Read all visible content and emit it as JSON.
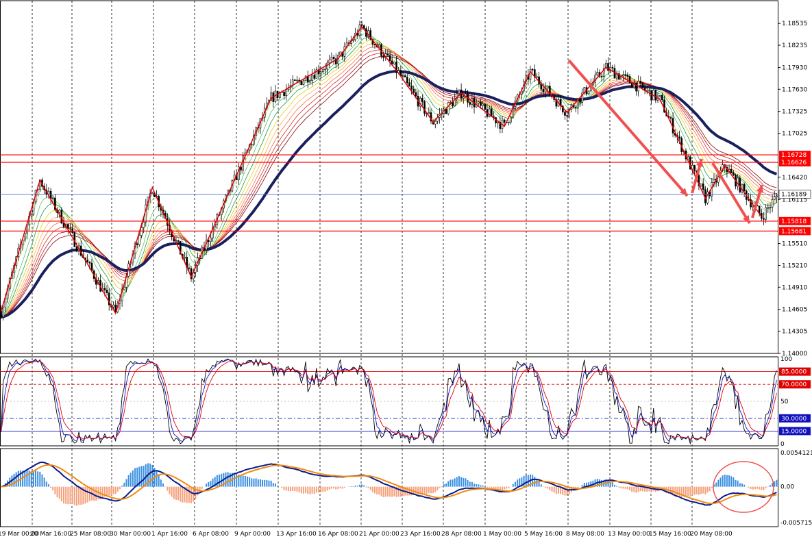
{
  "chart_data": [
    {
      "type": "candlestick",
      "panel": "price",
      "ylim": [
        1.14,
        1.188
      ],
      "y_ticks": [
        "1.18535",
        "1.18235",
        "1.17930",
        "1.17630",
        "1.17325",
        "1.17025",
        "1.16420",
        "1.16115",
        "1.15510",
        "1.15210",
        "1.14910",
        "1.14605",
        "1.14305",
        "1.14000"
      ],
      "y_tick_values": [
        1.18535,
        1.18235,
        1.1793,
        1.1763,
        1.17325,
        1.17025,
        1.1642,
        1.16115,
        1.1551,
        1.1521,
        1.1491,
        1.14605,
        1.14305,
        1.14
      ],
      "x_ticks": [
        "19 Mar 00:00",
        "20 Mar 16:00",
        "25 Mar 08:00",
        "30 Mar 00:00",
        "1 Apr 16:00",
        "6 Apr 08:00",
        "9 Apr 00:00",
        "13 Apr 16:00",
        "16 Apr 08:00",
        "21 Apr 00:00",
        "23 Apr 16:00",
        "28 Apr 08:00",
        "1 May 00:00",
        "5 May 16:00",
        "8 May 08:00",
        "13 May 00:00",
        "15 May 16:00",
        "20 May 08:00"
      ],
      "current_price": "1.16189",
      "levels": [
        {
          "label": "1.16728",
          "value": 1.16728,
          "color": "#ff0000"
        },
        {
          "label": "1.16626",
          "value": 1.16626,
          "color": "#ff0000"
        },
        {
          "label": "1.15818",
          "value": 1.15818,
          "color": "#ff0000"
        },
        {
          "label": "1.15681",
          "value": 1.15681,
          "color": "#ff0000"
        }
      ],
      "zigzag": [
        [
          0,
          1.1458
        ],
        [
          18,
          1.1638
        ],
        [
          53,
          1.1455
        ],
        [
          70,
          1.1628
        ],
        [
          88,
          1.1505
        ],
        [
          125,
          1.1751
        ],
        [
          156,
          1.1805
        ],
        [
          167,
          1.1849
        ],
        [
          184,
          1.1785
        ],
        [
          200,
          1.1718
        ],
        [
          213,
          1.1758
        ],
        [
          233,
          1.1712
        ],
        [
          245,
          1.1787
        ],
        [
          262,
          1.1731
        ],
        [
          280,
          1.1793
        ],
        [
          305,
          1.1749
        ],
        [
          326,
          1.1613
        ],
        [
          335,
          1.1658
        ],
        [
          352,
          1.1588
        ]
      ],
      "annotations": [
        "red trend arrows down-right",
        "red rebound arrows up",
        "red circle around MACD recent histogram"
      ]
    },
    {
      "type": "line",
      "panel": "stochastic",
      "ylim": [
        0,
        100
      ],
      "y_ticks": [
        "100",
        "85.0000",
        "70.0000",
        "50",
        "30.0000",
        "15.0000",
        "0"
      ],
      "levels": [
        85,
        70,
        30,
        15
      ]
    },
    {
      "type": "bar",
      "panel": "macd",
      "y_ticks": [
        "0.0054121",
        "0.00",
        "-0.0057156"
      ],
      "ylim": [
        -0.0057156,
        0.0054121
      ]
    }
  ]
}
